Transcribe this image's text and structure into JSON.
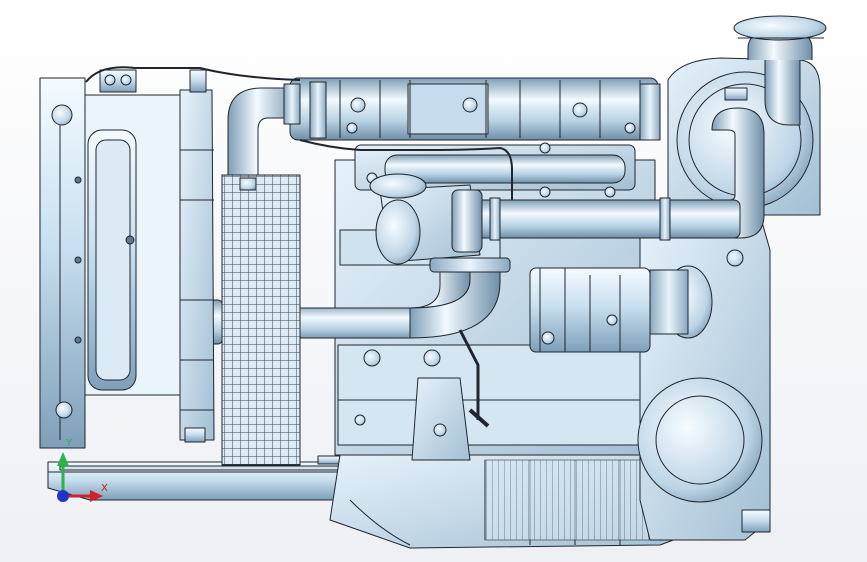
{
  "scene": {
    "subject": "engine-assembly-side-view",
    "colors": {
      "background": "#eef0f4",
      "metal_light": "#e3f1fb",
      "metal_mid": "#a9c6dc",
      "metal_dark": "#6e8ea8",
      "edge": "#20262e",
      "axis_x": "#d4202a",
      "axis_y": "#2bb24a",
      "axis_z": "#2233c8"
    }
  },
  "triad": {
    "x_label": "X",
    "y_label": "Y"
  }
}
